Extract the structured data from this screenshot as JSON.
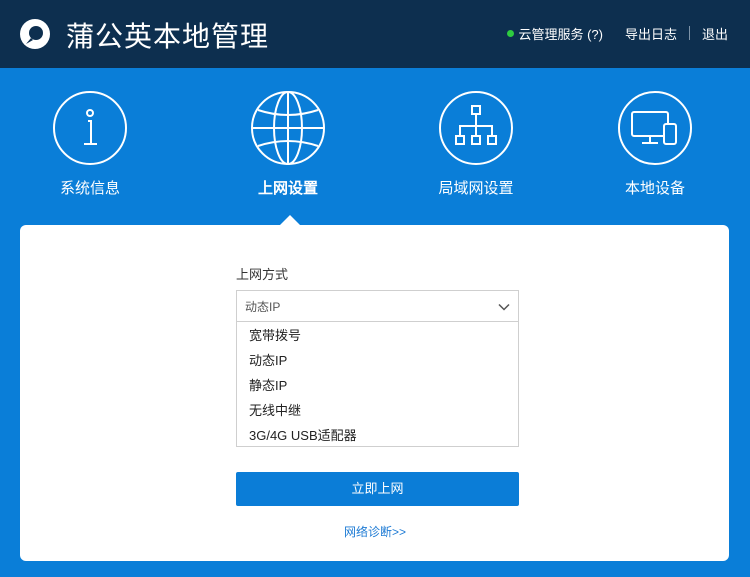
{
  "header": {
    "brand": "蒲公英本地管理",
    "cloud_service": "云管理服务 (?)",
    "export_log": "导出日志",
    "logout": "退出",
    "status_color": "#2ecc40"
  },
  "nav": {
    "items": [
      {
        "label": "系统信息",
        "icon": "info-icon"
      },
      {
        "label": "上网设置",
        "icon": "globe-icon",
        "active": true
      },
      {
        "label": "局域网设置",
        "icon": "network-tree-icon"
      },
      {
        "label": "本地设备",
        "icon": "devices-icon"
      }
    ]
  },
  "form": {
    "label": "上网方式",
    "selected": "动态IP",
    "options": [
      "宽带拨号",
      "动态IP",
      "静态IP",
      "无线中继",
      "3G/4G USB适配器"
    ],
    "submit": "立即上网",
    "diagnose": "网络诊断>>"
  },
  "colors": {
    "header_bg": "#0d2f4f",
    "main_bg": "#0a7ed8",
    "button": "#0b7dd7",
    "link": "#1e7bd4"
  }
}
